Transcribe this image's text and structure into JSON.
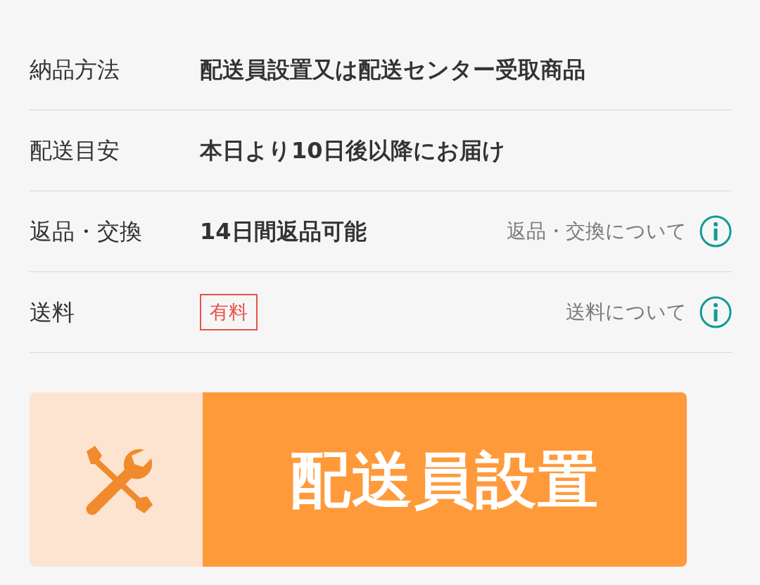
{
  "rows": [
    {
      "label": "納品方法",
      "value": "配送員設置又は配送センター受取商品",
      "kind": "text"
    },
    {
      "label": "配送目安",
      "value": "本日より10日後以降にお届け",
      "kind": "text"
    },
    {
      "label": "返品・交換",
      "value": "14日間返品可能",
      "kind": "text",
      "link": "返品・交換について"
    },
    {
      "label": "送料",
      "value": "有料",
      "kind": "badge",
      "link": "送料について"
    }
  ],
  "banner": {
    "title": "配送員設置"
  }
}
